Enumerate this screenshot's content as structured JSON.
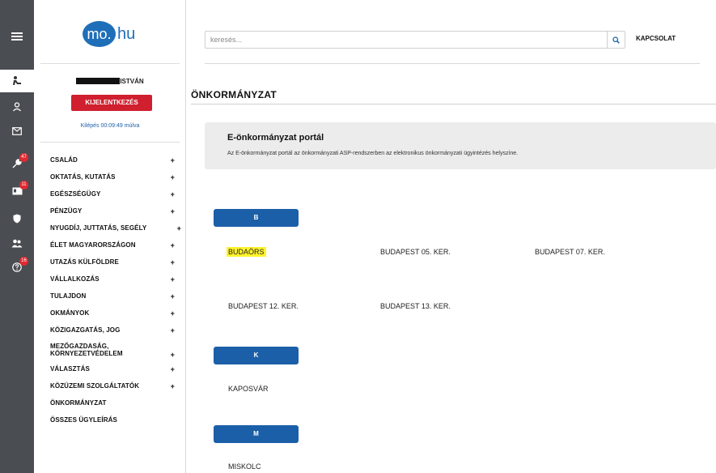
{
  "rail": {
    "badges": [
      "47",
      "11",
      "16"
    ]
  },
  "sidebar": {
    "logo": {
      "circle": "mo.",
      "text": "hu"
    },
    "user_name": "ISTVÁN",
    "logout_label": "KIJELENTKEZÉS",
    "session_timer": "Kilépés 00:09:49 múlva",
    "nav": [
      {
        "label": "CSALÁD",
        "plus": "+"
      },
      {
        "label": "OKTATÁS, KUTATÁS",
        "plus": "+"
      },
      {
        "label": "EGÉSZSÉGÜGY",
        "plus": "+"
      },
      {
        "label": "PÉNZÜGY",
        "plus": "+"
      },
      {
        "label": "NYUGDÍJ, JUTTATÁS, SEGÉLY",
        "plus": "+"
      },
      {
        "label": "ÉLET MAGYARORSZÁGON",
        "plus": "+"
      },
      {
        "label": "UTAZÁS KÜLFÖLDRE",
        "plus": "+"
      },
      {
        "label": "VÁLLALKOZÁS",
        "plus": "+"
      },
      {
        "label": "TULAJDON",
        "plus": "+"
      },
      {
        "label": "OKMÁNYOK",
        "plus": "+"
      },
      {
        "label": "KÖZIGAZGATÁS, JOG",
        "plus": "+"
      },
      {
        "label": "MEZŐGAZDASÁG, KÖRNYEZETVÉDELEM",
        "plus": "+"
      },
      {
        "label": "VÁLASZTÁS",
        "plus": "+"
      },
      {
        "label": "KÖZÜZEMI SZOLGÁLTATÓK",
        "plus": "+"
      },
      {
        "label": "ÖNKORMÁNYZAT",
        "plus": ""
      },
      {
        "label": "ÖSSZES ÜGYLEÍRÁS",
        "plus": ""
      }
    ]
  },
  "header": {
    "search_placeholder": "keresés...",
    "contact_label": "KAPCSOLAT"
  },
  "main": {
    "page_title": "ÖNKORMÁNYZAT",
    "portal": {
      "title": "E-önkormányzat portál",
      "description": "Az E-önkormányzat portál az önkormányzati ASP-rendszerben az elektronikus önkormányzati ügyintézés helyszíne."
    },
    "groups": [
      {
        "letter": "B",
        "cities": [
          "BUDAÖRS",
          "BUDAPEST 05. KER.",
          "BUDAPEST 07. KER.",
          "BUDAPEST 12. KER.",
          "BUDAPEST 13. KER."
        ]
      },
      {
        "letter": "K",
        "cities": [
          "KAPOSVÁR"
        ]
      },
      {
        "letter": "M",
        "cities": [
          "MISKOLC"
        ]
      }
    ]
  },
  "colors": {
    "rail": "#4a4d52",
    "brand_blue": "#1f6fb8",
    "button_blue": "#1b5fa8",
    "logout_red": "#d01f2e",
    "highlight": "#fff32a"
  }
}
